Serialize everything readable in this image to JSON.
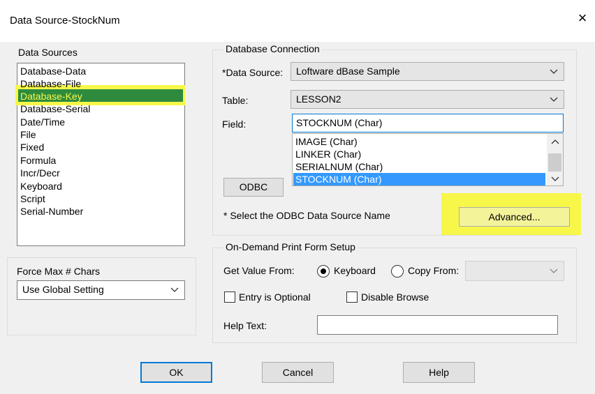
{
  "window": {
    "title": "Data Source-StockNum",
    "close_icon": "×"
  },
  "data_sources": {
    "label": "Data Sources",
    "items": [
      "Database-Data",
      "Database-File",
      "Database-Key",
      "Database-Serial",
      "Date/Time",
      "File",
      "Fixed",
      "Formula",
      "Incr/Decr",
      "Keyboard",
      "Script",
      "Serial-Number"
    ],
    "selected": "Database-Key"
  },
  "force_max": {
    "label": "Force Max # Chars",
    "value": "Use Global Setting"
  },
  "db_connection": {
    "label": "Database  Connection",
    "data_source_label": "*Data Source:",
    "data_source_value": "Loftware dBase Sample",
    "table_label": "Table:",
    "table_value": "LESSON2",
    "field_label": "Field:",
    "field_value": "STOCKNUM (Char)",
    "field_options": [
      "IMAGE (Char)",
      "LINKER (Char)",
      "SERIALNUM (Char)",
      "STOCKNUM (Char)"
    ],
    "field_selected": "STOCKNUM (Char)",
    "odbc_button": "ODBC",
    "note": "* Select the ODBC Data Source Name",
    "advanced_button": "Advanced..."
  },
  "on_demand": {
    "label": "On-Demand Print Form Setup",
    "get_value_label": "Get Value From:",
    "keyboard_label": "Keyboard",
    "copy_from_label": "Copy From:",
    "copy_from_value": "",
    "entry_optional_label": "Entry is Optional",
    "disable_browse_label": "Disable Browse",
    "help_text_label": "Help Text:",
    "help_text_value": ""
  },
  "buttons": {
    "ok": "OK",
    "cancel": "Cancel",
    "help": "Help"
  },
  "colors": {
    "selection_blue": "#3399ff",
    "selection_green": "#2e8b3e",
    "highlight_yellow": "#f7f74a",
    "default_button_border": "#0078d7"
  }
}
